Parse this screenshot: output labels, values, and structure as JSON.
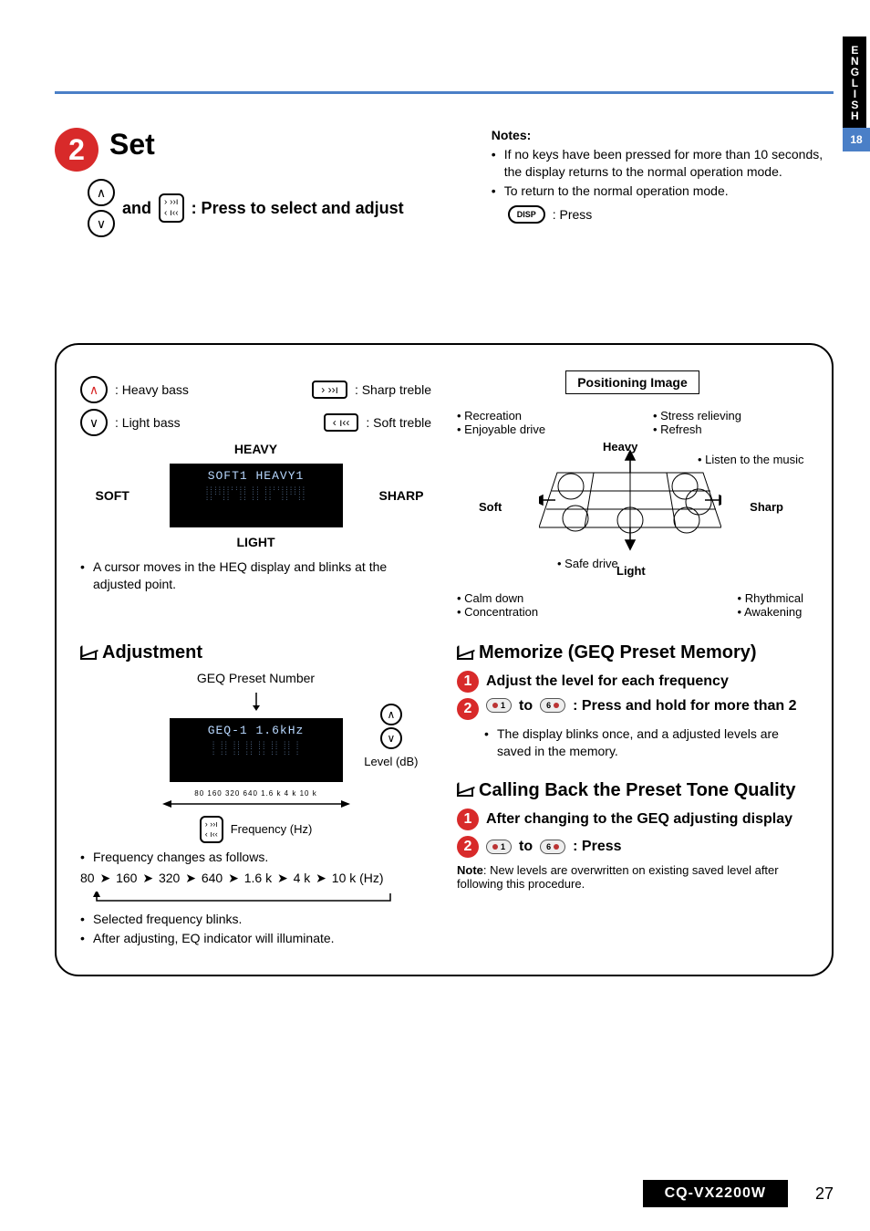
{
  "lang_tab": {
    "label": "ENGLISH",
    "page_chip": "18"
  },
  "step2": {
    "num": "2",
    "title": "Set",
    "and": "and",
    "press_select_adjust": ": Press to select and adjust"
  },
  "notes": {
    "heading": "Notes:",
    "items": [
      "If no keys have been pressed for more than 10 seconds, the display returns to the normal operation mode.",
      "To return to the normal operation mode."
    ],
    "disp_label": "DISP",
    "disp_press": ": Press"
  },
  "heq_box": {
    "heavy_bass": ": Heavy bass",
    "light_bass": ": Light bass",
    "sharp_treble": ": Sharp treble",
    "soft_treble": ": Soft treble",
    "top_label": "HEAVY",
    "left_label": "SOFT",
    "right_label": "SHARP",
    "bottom_label": "LIGHT",
    "display_text": "SOFT1 HEAVY1",
    "cursor_note": "A cursor moves in the HEQ display and blinks at the adjusted point."
  },
  "positioning": {
    "title": "Positioning Image",
    "top_left": [
      "• Recreation",
      "• Enjoyable drive"
    ],
    "top_right": [
      "• Stress relieving",
      "• Refresh"
    ],
    "far_right": "• Listen to the music",
    "left": "Soft",
    "right": "Sharp",
    "top_mid": "Heavy",
    "bottom_mid": "Light",
    "bottom_left": [
      "• Calm down",
      "• Concentration"
    ],
    "bottom_center": "• Safe drive",
    "bottom_right": [
      "• Rhythmical",
      "• Awakening"
    ]
  },
  "adjustment": {
    "heading": "Adjustment",
    "geq_preset_number": "GEQ Preset Number",
    "display_text": "GEQ-1 1.6kHz",
    "freq_ticks": "80  160  320  640  1.6 k  4 k  10 k",
    "level_label": "Level (dB)",
    "frequency_label": "Frequency (Hz)",
    "freq_changes": "Frequency changes as follows.",
    "chain": [
      "80",
      "160",
      "320",
      "640",
      "1.6 k",
      "4 k",
      "10 k (Hz)"
    ],
    "notes": [
      "Selected frequency blinks.",
      "After adjusting, EQ indicator will illuminate."
    ]
  },
  "memorize": {
    "heading": "Memorize (GEQ Preset Memory)",
    "step1": "Adjust the level for each frequency",
    "preset_from": "1",
    "to": "to",
    "preset_to": "6",
    "press_hold": ": Press and hold for more than 2",
    "desc": "The display blinks once, and a adjusted levels are saved in the memory."
  },
  "calling_back": {
    "heading": "Calling Back the Preset Tone Quality",
    "step1": "After changing to the GEQ adjusting display",
    "preset_from": "1",
    "to": "to",
    "preset_to": "6",
    "press": ": Press",
    "note_label": "Note",
    "note_body": ": New levels are overwritten on existing saved level after following this procedure."
  },
  "footer": {
    "model": "CQ-VX2200W",
    "page": "27"
  },
  "chart_data": {
    "type": "table",
    "title": "Positioning Image quadrant meanings",
    "axes": {
      "x": [
        "Soft",
        "Sharp"
      ],
      "y": [
        "Light",
        "Heavy"
      ]
    },
    "cells": {
      "Heavy,Soft": [
        "Recreation",
        "Enjoyable drive"
      ],
      "Heavy,Sharp": [
        "Stress relieving",
        "Refresh"
      ],
      "Sharp,mid": [
        "Listen to the music"
      ],
      "Light,Soft": [
        "Calm down",
        "Concentration"
      ],
      "Light,mid": [
        "Safe drive"
      ],
      "Light,Sharp": [
        "Rhythmical",
        "Awakening"
      ]
    }
  }
}
